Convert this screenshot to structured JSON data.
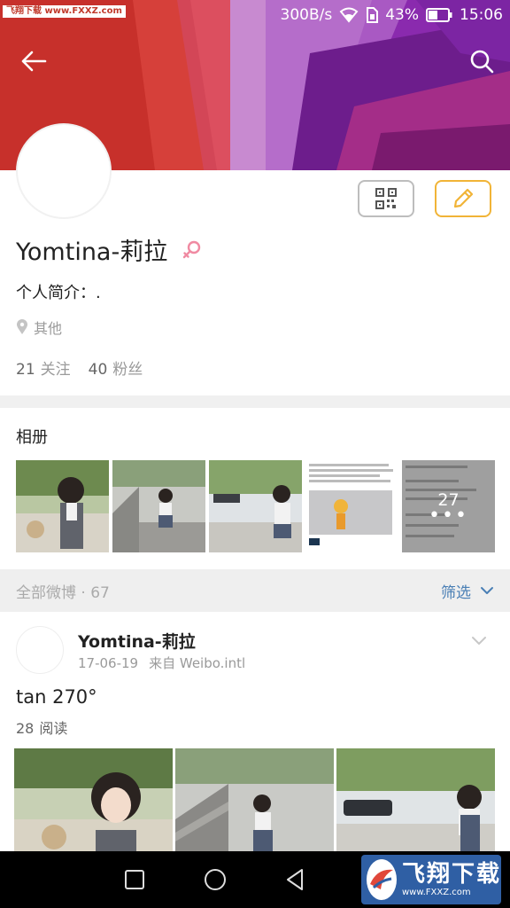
{
  "watermark": {
    "top_text": "飞翔下载 www.FXXZ.com",
    "logo_text": "飞翔下载",
    "logo_url": "www.FXXZ.com"
  },
  "status_bar": {
    "speed": "300B/s",
    "battery": "43%",
    "time": "15:06"
  },
  "profile": {
    "name": "Yomtina-莉拉",
    "bio": "个人简介：.",
    "location": "其他",
    "following_count": "21",
    "following_label": "关注",
    "followers_count": "40",
    "followers_label": "粉丝"
  },
  "album": {
    "title": "相册",
    "more_count": "27",
    "more_dots": "•••"
  },
  "weibo_list": {
    "all_label": "全部微博 · 67",
    "filter_label": "筛选"
  },
  "post": {
    "user": "Yomtina-莉拉",
    "date": "17-06-19",
    "source": "来自 Weibo.intl",
    "text": "tan 270°",
    "reads": "28",
    "reads_label": "阅读"
  },
  "colors": {
    "accent_edit": "#f1b437",
    "link_blue": "#4a7fb5",
    "banner_purple": "#8e2bb2",
    "banner_red": "#c9302c"
  },
  "icons": [
    "back-arrow-icon",
    "search-icon",
    "wifi-icon",
    "sim-icon",
    "battery-icon",
    "qr-code-icon",
    "pencil-icon",
    "female-gender-icon",
    "location-pin-icon",
    "chevron-down-icon",
    "square-icon",
    "circle-icon",
    "triangle-back-icon"
  ]
}
